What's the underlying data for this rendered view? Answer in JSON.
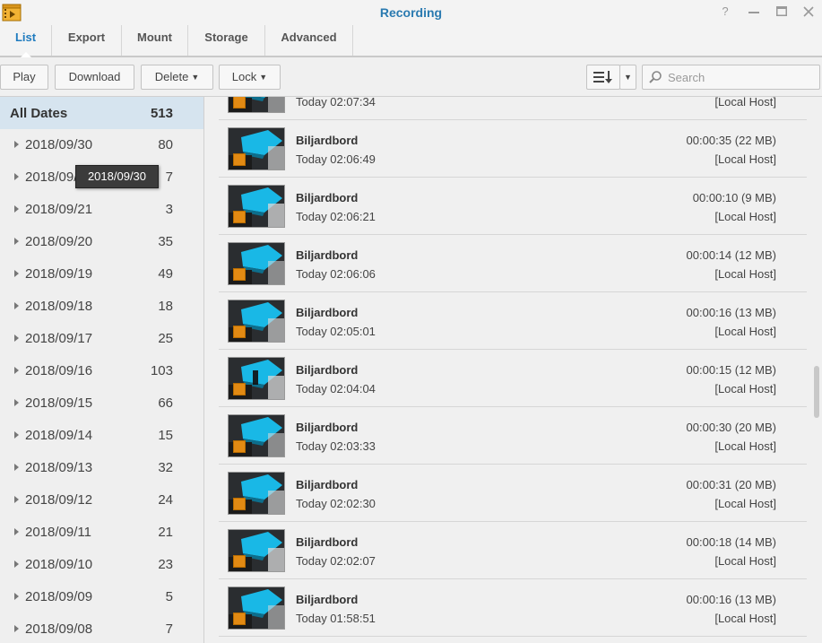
{
  "window": {
    "title": "Recording",
    "controls": [
      "help-icon",
      "minimize-icon",
      "maximize-icon",
      "close-icon"
    ]
  },
  "tabs": [
    {
      "label": "List",
      "active": true
    },
    {
      "label": "Export",
      "active": false
    },
    {
      "label": "Mount",
      "active": false
    },
    {
      "label": "Storage",
      "active": false
    },
    {
      "label": "Advanced",
      "active": false
    }
  ],
  "toolbar": {
    "play": "Play",
    "download": "Download",
    "delete": "Delete",
    "lock": "Lock",
    "search_placeholder": "Search"
  },
  "sidebar": {
    "all_dates": {
      "label": "All Dates",
      "count": "513"
    },
    "dates": [
      {
        "date": "2018/09/30",
        "count": "80"
      },
      {
        "date": "2018/09/22",
        "count": "7"
      },
      {
        "date": "2018/09/21",
        "count": "3"
      },
      {
        "date": "2018/09/20",
        "count": "35"
      },
      {
        "date": "2018/09/19",
        "count": "49"
      },
      {
        "date": "2018/09/18",
        "count": "18"
      },
      {
        "date": "2018/09/17",
        "count": "25"
      },
      {
        "date": "2018/09/16",
        "count": "103"
      },
      {
        "date": "2018/09/15",
        "count": "66"
      },
      {
        "date": "2018/09/14",
        "count": "15"
      },
      {
        "date": "2018/09/13",
        "count": "32"
      },
      {
        "date": "2018/09/12",
        "count": "24"
      },
      {
        "date": "2018/09/11",
        "count": "21"
      },
      {
        "date": "2018/09/10",
        "count": "23"
      },
      {
        "date": "2018/09/09",
        "count": "5"
      },
      {
        "date": "2018/09/08",
        "count": "7"
      }
    ],
    "tooltip": "2018/09/30"
  },
  "recordings": [
    {
      "name": "",
      "time": "Today 02:07:34",
      "duration": "",
      "host": "[Local Host]"
    },
    {
      "name": "Biljardbord",
      "time": "Today 02:06:49",
      "duration": "00:00:35 (22 MB)",
      "host": "[Local Host]"
    },
    {
      "name": "Biljardbord",
      "time": "Today 02:06:21",
      "duration": "00:00:10 (9 MB)",
      "host": "[Local Host]"
    },
    {
      "name": "Biljardbord",
      "time": "Today 02:06:06",
      "duration": "00:00:14 (12 MB)",
      "host": "[Local Host]"
    },
    {
      "name": "Biljardbord",
      "time": "Today 02:05:01",
      "duration": "00:00:16 (13 MB)",
      "host": "[Local Host]"
    },
    {
      "name": "Biljardbord",
      "time": "Today 02:04:04",
      "duration": "00:00:15 (12 MB)",
      "host": "[Local Host]"
    },
    {
      "name": "Biljardbord",
      "time": "Today 02:03:33",
      "duration": "00:00:30 (20 MB)",
      "host": "[Local Host]"
    },
    {
      "name": "Biljardbord",
      "time": "Today 02:02:30",
      "duration": "00:00:31 (20 MB)",
      "host": "[Local Host]"
    },
    {
      "name": "Biljardbord",
      "time": "Today 02:02:07",
      "duration": "00:00:18 (14 MB)",
      "host": "[Local Host]"
    },
    {
      "name": "Biljardbord",
      "time": "Today 01:58:51",
      "duration": "00:00:16 (13 MB)",
      "host": "[Local Host]"
    }
  ],
  "colors": {
    "accent": "#1f7bbf",
    "title": "#2a7ab0",
    "selected_bg": "#d6e4ef",
    "lock_badge": "#e28a13",
    "thumb_table": "#19b8e6"
  }
}
